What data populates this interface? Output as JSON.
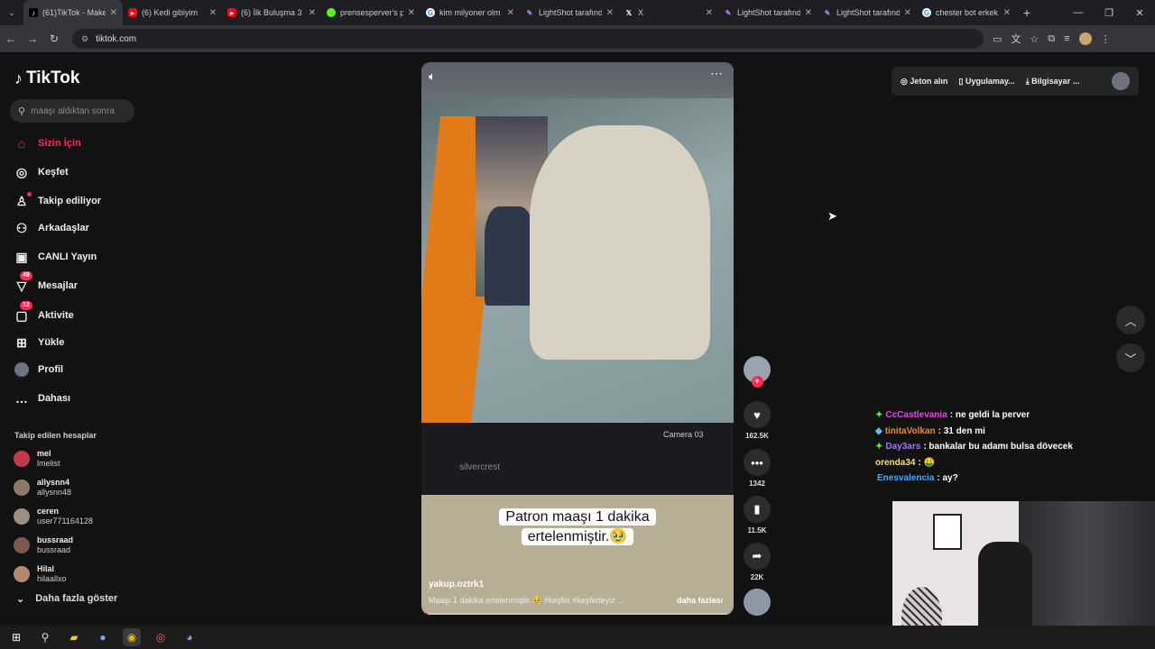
{
  "browser": {
    "tabs": [
      {
        "title": "(61)TikTok - Make",
        "favicon": "tiktok-icon",
        "active": true
      },
      {
        "title": "(6) Kedi gibiyim",
        "favicon": "youtube-icon"
      },
      {
        "title": "(6) İlk Buluşma 3 1",
        "favicon": "youtube-icon"
      },
      {
        "title": "prensesperver's p",
        "favicon": "kick-icon"
      },
      {
        "title": "kim milyoner olm",
        "favicon": "google-icon"
      },
      {
        "title": "LightShot tarafınd",
        "favicon": "lightshot-icon"
      },
      {
        "title": "X",
        "favicon": "x-icon"
      },
      {
        "title": "LightShot tarafınd",
        "favicon": "lightshot-icon"
      },
      {
        "title": "LightShot tarafınd",
        "favicon": "lightshot-icon"
      },
      {
        "title": "chester bot erkek",
        "favicon": "google-icon"
      }
    ],
    "url": "tiktok.com"
  },
  "sidebar": {
    "logo": "TikTok",
    "search_placeholder": "maaşı aldıktan sonra",
    "nav": [
      {
        "label": "Sizin İçin",
        "icon": "home-icon",
        "active": true
      },
      {
        "label": "Keşfet",
        "icon": "compass-icon"
      },
      {
        "label": "Takip ediliyor",
        "icon": "following-icon"
      },
      {
        "label": "Arkadaşlar",
        "icon": "friends-icon"
      },
      {
        "label": "CANLI Yayın",
        "icon": "live-icon"
      },
      {
        "label": "Mesajlar",
        "icon": "messages-icon",
        "badge": "49"
      },
      {
        "label": "Aktivite",
        "icon": "activity-icon",
        "badge": "12"
      },
      {
        "label": "Yükle",
        "icon": "upload-icon"
      },
      {
        "label": "Profil",
        "icon": "profile-icon"
      },
      {
        "label": "Dahası",
        "icon": "more-icon"
      }
    ],
    "following_title": "Takip edilen hesaplar",
    "following": [
      {
        "name": "mel",
        "handle": "lmelist"
      },
      {
        "name": "allysnn4",
        "handle": "allysnn48"
      },
      {
        "name": "ceren",
        "handle": "user771164128"
      },
      {
        "name": "bussraad",
        "handle": "bussraad"
      },
      {
        "name": "Hilal",
        "handle": "hilaallxo"
      }
    ],
    "show_more": "Daha fazla göster"
  },
  "video": {
    "caption_line1": "Patron maaşı 1 dakika",
    "caption_line2": "ertelenmiştir.🥹",
    "author": "yakup.oztrk1",
    "description": "Maaşı 1 dakika ertelenmiştir.🥹 #keşfet #keşfetteyiz ...",
    "more_label": "daha fazlası",
    "monitor_brand": "silvercrest",
    "monitor_label": "Camera 03",
    "progress": 0.02
  },
  "actions": {
    "likes": "162.5K",
    "comments": "1342",
    "saves": "11.5K",
    "shares": "22K"
  },
  "topright": {
    "coins": "Jeton alın",
    "app": "Uygulamay...",
    "desktop": "Bilgisayar ..."
  },
  "chat": [
    {
      "user": "CcCastlevania",
      "msg": ": ne geldi la perver",
      "color": "#e04cd8"
    },
    {
      "user": "tinitaVolkan",
      "msg": ": 31 den mi",
      "color": "#e98c2f"
    },
    {
      "user": "Day3ars",
      "msg": ": bankalar bu adamı bulsa dövecek",
      "color": "#9b7bf3"
    },
    {
      "user": "orenda34",
      "msg": ": 🤑",
      "color": "#f6e36a"
    },
    {
      "user": "Enesvalencia",
      "msg": ": ay?",
      "color": "#4ea7f5"
    }
  ],
  "colors": {
    "accent": "#fe2c55",
    "bg": "#121212"
  }
}
